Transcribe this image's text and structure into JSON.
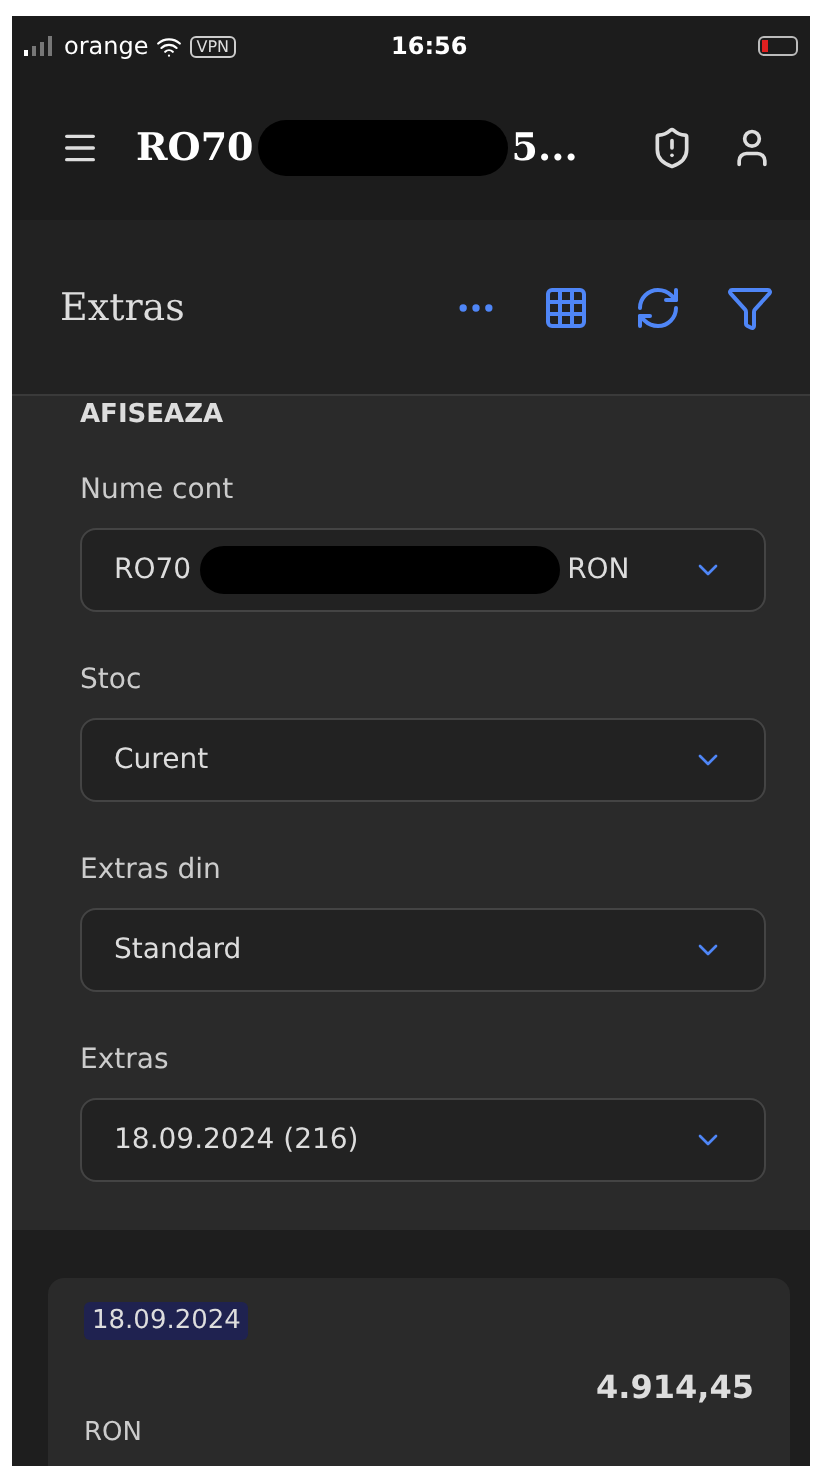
{
  "status_bar": {
    "carrier": "orange",
    "vpn": "VPN",
    "time": "16:56"
  },
  "top_bar": {
    "title_start": "RO70",
    "title_end": "5..."
  },
  "section": {
    "title": "Extras"
  },
  "filters": {
    "heading": "AFISEAZA",
    "fields": [
      {
        "label": "Nume cont",
        "value_start": "RO70",
        "value_end": "RON",
        "redacted": true
      },
      {
        "label": "Stoc",
        "value_start": "Curent",
        "redacted": false
      },
      {
        "label": "Extras din",
        "value_start": "Standard",
        "redacted": false
      },
      {
        "label": "Extras",
        "value_start": "18.09.2024 (216)",
        "redacted": false
      }
    ]
  },
  "statement": {
    "date": "18.09.2024",
    "amount": "4.914,45",
    "currency": "RON"
  }
}
